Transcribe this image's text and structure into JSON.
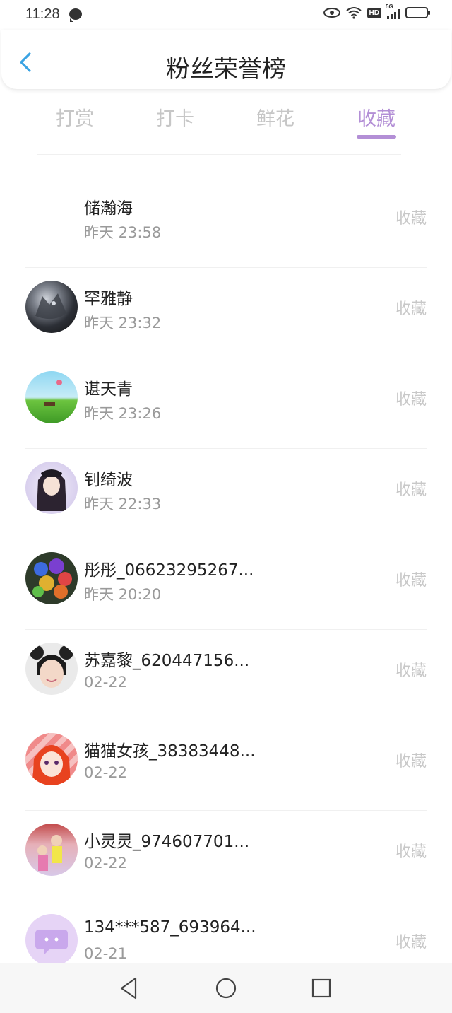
{
  "status_bar": {
    "time": "11:28",
    "network": "5G",
    "hd": "HD"
  },
  "header": {
    "title": "粉丝荣誉榜"
  },
  "tabs": [
    {
      "label": "打赏",
      "active": false
    },
    {
      "label": "打卡",
      "active": false
    },
    {
      "label": "鲜花",
      "active": false
    },
    {
      "label": "收藏",
      "active": true
    }
  ],
  "list": [
    {
      "name": "储瀚海",
      "time": "昨天 23:58",
      "action": "收藏",
      "avatar": "none"
    },
    {
      "name": "罕雅静",
      "time": "昨天 23:32",
      "action": "收藏",
      "avatar": "wolf"
    },
    {
      "name": "谌天青",
      "time": "昨天 23:26",
      "action": "收藏",
      "avatar": "landscape"
    },
    {
      "name": "钊绮波",
      "time": "昨天 22:33",
      "action": "收藏",
      "avatar": "anime-girl"
    },
    {
      "name": "彤彤_06623295267...",
      "time": "昨天 20:20",
      "action": "收藏",
      "avatar": "roses"
    },
    {
      "name": "苏嘉黎_620447156...",
      "time": "02-22",
      "action": "收藏",
      "avatar": "girl-photo"
    },
    {
      "name": "猫猫女孩_38383448...",
      "time": "02-22",
      "action": "收藏",
      "avatar": "cat-girl"
    },
    {
      "name": "小灵灵_974607701...",
      "time": "02-22",
      "action": "收藏",
      "avatar": "girls-photo"
    },
    {
      "name": "134***587_693964...",
      "time": "02-21",
      "action": "收藏",
      "avatar": "default-chat"
    }
  ],
  "colors": {
    "accent": "#b38fd6",
    "tab_inactive": "#c6c6c6",
    "back_arrow": "#3aa3e3"
  }
}
